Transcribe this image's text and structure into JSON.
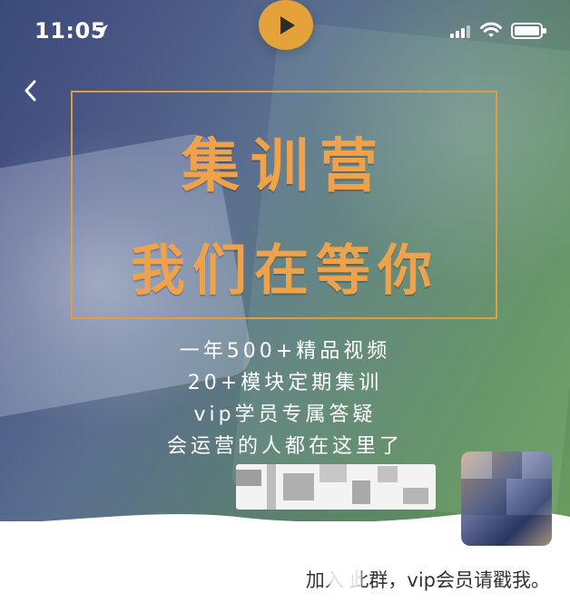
{
  "status_bar": {
    "time": "11:05",
    "icons": [
      "location-arrow-icon",
      "cellular-signal-icon",
      "wifi-icon",
      "battery-icon"
    ]
  },
  "header": {
    "back_icon": "chevron-left-icon",
    "play_icon": "play-icon"
  },
  "poster": {
    "title_line_1": "集训营",
    "title_line_2": "我们在等你",
    "details": [
      "一年500+精品视频",
      "20+模块定期集训",
      "vip学员专属答疑",
      "会运营的人都在这里了"
    ]
  },
  "caption": {
    "text": "加入  此群，vip会员请戳我。"
  },
  "colors": {
    "accent_orange": "#efa24a",
    "frame_orange": "#e99c3f"
  }
}
